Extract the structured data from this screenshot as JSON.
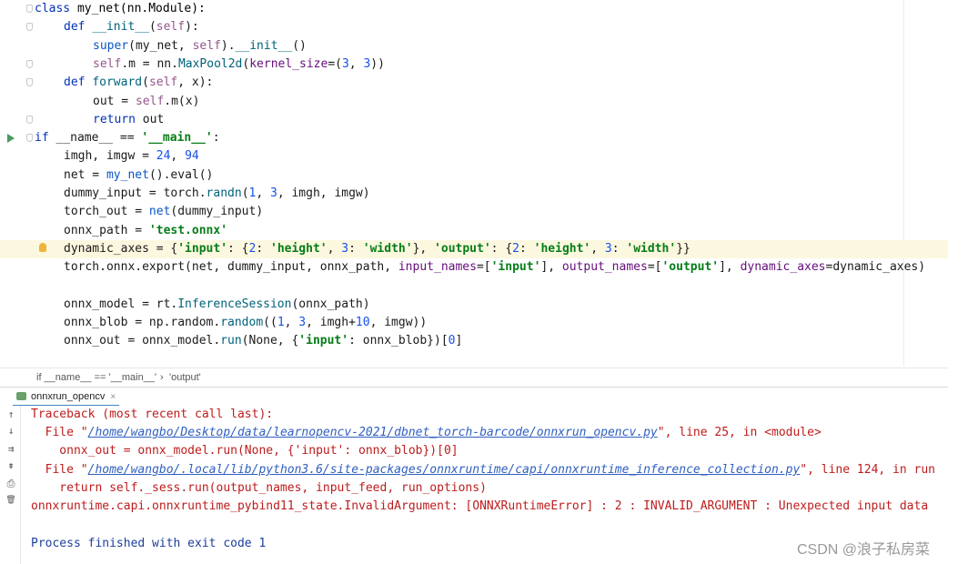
{
  "editor": {
    "lines": [
      {
        "parts": [
          [
            "kw",
            "class "
          ],
          [
            "cls",
            "my_net(nn.Module):"
          ]
        ]
      },
      {
        "parts": [
          [
            "kw",
            "def "
          ],
          [
            "dfn",
            "__init__"
          ],
          [
            "plain",
            "("
          ],
          [
            "slf",
            "self"
          ],
          [
            "plain",
            "):"
          ]
        ]
      },
      {
        "parts": [
          [
            "fn",
            "super"
          ],
          [
            "plain",
            "(my_net, "
          ],
          [
            "slf",
            "self"
          ],
          [
            "plain",
            ")."
          ],
          [
            "dfn",
            "__init__"
          ],
          [
            "plain",
            "()"
          ]
        ]
      },
      {
        "parts": [
          [
            "slf",
            "self"
          ],
          [
            "plain",
            ".m = nn."
          ],
          [
            "dfn",
            "MaxPool2d"
          ],
          [
            "plain",
            "("
          ],
          [
            "prm",
            "kernel_size"
          ],
          [
            "plain",
            "=("
          ],
          [
            "num",
            "3"
          ],
          [
            "plain",
            ", "
          ],
          [
            "num",
            "3"
          ],
          [
            "plain",
            "))"
          ]
        ]
      },
      {
        "parts": [
          [
            "kw",
            "def "
          ],
          [
            "dfn",
            "forward"
          ],
          [
            "plain",
            "("
          ],
          [
            "slf",
            "self"
          ],
          [
            "plain",
            ", x):"
          ]
        ]
      },
      {
        "parts": [
          [
            "plain",
            "out = "
          ],
          [
            "slf",
            "self"
          ],
          [
            "plain",
            ".m(x)"
          ]
        ]
      },
      {
        "parts": [
          [
            "kw",
            "return "
          ],
          [
            "plain",
            "out"
          ]
        ]
      },
      {
        "parts": [
          [
            "kw",
            "if "
          ],
          [
            "plain",
            "__name__ == "
          ],
          [
            "str",
            "'__main__'"
          ],
          [
            "plain",
            ":"
          ]
        ]
      },
      {
        "parts": [
          [
            "plain",
            "imgh, imgw = "
          ],
          [
            "num",
            "24"
          ],
          [
            "plain",
            ", "
          ],
          [
            "num",
            "94"
          ]
        ]
      },
      {
        "parts": [
          [
            "plain",
            "net = "
          ],
          [
            "fn",
            "my_net"
          ],
          [
            "plain",
            "().eval()"
          ]
        ]
      },
      {
        "parts": [
          [
            "plain",
            "dummy_input = torch."
          ],
          [
            "dfn",
            "randn"
          ],
          [
            "plain",
            "("
          ],
          [
            "num",
            "1"
          ],
          [
            "plain",
            ", "
          ],
          [
            "num",
            "3"
          ],
          [
            "plain",
            ", imgh, imgw)"
          ]
        ]
      },
      {
        "parts": [
          [
            "plain",
            "torch_out = "
          ],
          [
            "fn",
            "net"
          ],
          [
            "plain",
            "(dummy_input)"
          ]
        ]
      },
      {
        "parts": [
          [
            "plain",
            "onnx_path = "
          ],
          [
            "str",
            "'test.onnx'"
          ]
        ]
      },
      {
        "parts": [
          [
            "plain",
            "dynamic_axes = {"
          ],
          [
            "str",
            "'input'"
          ],
          [
            "plain",
            ": {"
          ],
          [
            "num",
            "2"
          ],
          [
            "plain",
            ": "
          ],
          [
            "str",
            "'height'"
          ],
          [
            "plain",
            ", "
          ],
          [
            "num",
            "3"
          ],
          [
            "plain",
            ": "
          ],
          [
            "str",
            "'width'"
          ],
          [
            "plain",
            "}, "
          ],
          [
            "str",
            "'output'"
          ],
          [
            "plain",
            ": {"
          ],
          [
            "num",
            "2"
          ],
          [
            "plain",
            ": "
          ],
          [
            "str",
            "'height'"
          ],
          [
            "plain",
            ", "
          ],
          [
            "num",
            "3"
          ],
          [
            "plain",
            ": "
          ],
          [
            "str",
            "'width'"
          ],
          [
            "plain",
            "}}"
          ]
        ]
      },
      {
        "parts": [
          [
            "plain",
            "torch.onnx.export(net, dummy_input, onnx_path, "
          ],
          [
            "prm",
            "input_names"
          ],
          [
            "plain",
            "=["
          ],
          [
            "str",
            "'input'"
          ],
          [
            "plain",
            "], "
          ],
          [
            "prm",
            "output_names"
          ],
          [
            "plain",
            "=["
          ],
          [
            "str",
            "'output'"
          ],
          [
            "plain",
            "], "
          ],
          [
            "prm",
            "dynamic_axes"
          ],
          [
            "plain",
            "=dynamic_axes)"
          ]
        ]
      },
      {
        "parts": []
      },
      {
        "parts": [
          [
            "plain",
            "onnx_model = rt."
          ],
          [
            "dfn",
            "InferenceSession"
          ],
          [
            "plain",
            "(onnx_path)"
          ]
        ]
      },
      {
        "parts": [
          [
            "plain",
            "onnx_blob = np.random."
          ],
          [
            "dfn",
            "random"
          ],
          [
            "plain",
            "(("
          ],
          [
            "num",
            "1"
          ],
          [
            "plain",
            ", "
          ],
          [
            "num",
            "3"
          ],
          [
            "plain",
            ", imgh+"
          ],
          [
            "num",
            "10"
          ],
          [
            "plain",
            ", imgw))"
          ]
        ]
      },
      {
        "parts": [
          [
            "plain",
            "onnx_out = onnx_model."
          ],
          [
            "dfn",
            "run"
          ],
          [
            "plain",
            "(None, {"
          ],
          [
            "str",
            "'input'"
          ],
          [
            "plain",
            ": onnx_blob})["
          ],
          [
            "num",
            "0"
          ],
          [
            "plain",
            "]"
          ]
        ]
      }
    ]
  },
  "breadcrumb": {
    "first": "if __name__ == '__main__'",
    "separator": "›",
    "second": "'output'"
  },
  "run_tab": {
    "label": "onnxrun_opencv",
    "close": "×"
  },
  "console": {
    "tools": [
      "↑",
      "↓",
      "⇉",
      "⇟",
      "⎙",
      "🗑"
    ],
    "traceback": "Traceback (most recent call last):",
    "file1_prefix": "  File \"",
    "file1_path": "/home/wangbo/Desktop/data/learnopencv-2021/dbnet_torch-barcode/onnxrun_opencv.py",
    "file1_suffix": "\", line 25, in <module>",
    "code1": "    onnx_out = onnx_model.run(None, {'input': onnx_blob})[0]",
    "file2_prefix": "  File \"",
    "file2_path": "/home/wangbo/.local/lib/python3.6/site-packages/onnxruntime/capi/onnxruntime_inference_collection.py",
    "file2_suffix": "\", line 124, in run",
    "code2": "    return self._sess.run(output_names, input_feed, run_options)",
    "error": "onnxruntime.capi.onnxruntime_pybind11_state.InvalidArgument: [ONNXRuntimeError] : 2 : INVALID_ARGUMENT : Unexpected input data",
    "finished": "Process finished with exit code 1"
  },
  "watermark": "CSDN @浪子私房菜"
}
